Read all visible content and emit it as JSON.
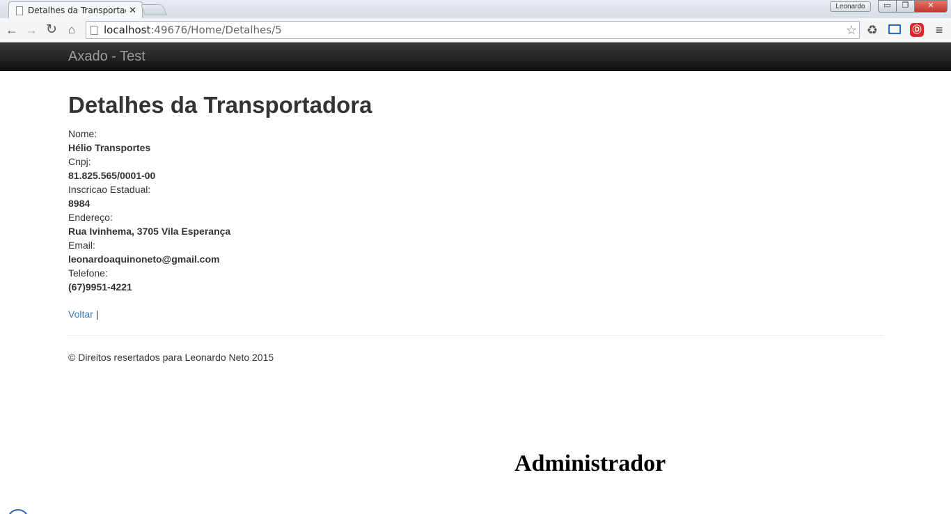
{
  "browser": {
    "tab_title": "Detalhes da Transportado",
    "tab_close": "✕",
    "profile_name": "Leonardo",
    "window_controls": {
      "minimize": "▭",
      "maximize": "❐",
      "close": "✕"
    },
    "nav": {
      "back": "←",
      "forward": "→",
      "reload": "↻",
      "home": "⌂"
    },
    "url_host": "localhost",
    "url_rest": ":49676/Home/Detalhes/5",
    "bookmark_star": "☆",
    "extensions": {
      "recycle": "♻",
      "adblock": "Ⓓ",
      "menu": "≡"
    }
  },
  "navbar": {
    "brand": "Axado - Test"
  },
  "page": {
    "title": "Detalhes da Transportadora",
    "fields": [
      {
        "label": "Nome:",
        "value": "Hélio Transportes"
      },
      {
        "label": "Cnpj:",
        "value": "81.825.565/0001-00"
      },
      {
        "label": "Inscricao Estadual:",
        "value": "8984"
      },
      {
        "label": "Endereço:",
        "value": "Rua Ivinhema, 3705 Vila Esperança"
      },
      {
        "label": "Email:",
        "value": "leonardoaquinoneto@gmail.com"
      },
      {
        "label": "Telefone:",
        "value": "(67)9951-4221"
      }
    ],
    "back_link": "Voltar",
    "separator": "|",
    "footer": "© Direitos resertados para Leonardo Neto 2015",
    "admin_heading": "Administrador"
  },
  "colors": {
    "link": "#337ab7",
    "navbar_bg": "#222222",
    "brand_text": "#9d9d9d",
    "text": "#333333"
  }
}
